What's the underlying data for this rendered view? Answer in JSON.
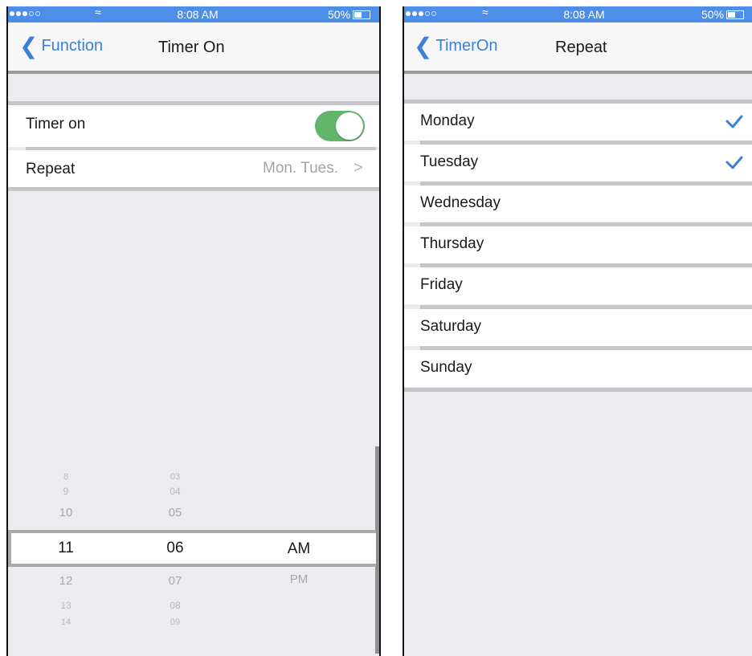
{
  "left_screen": {
    "status": {
      "time": "8:08 AM",
      "battery": "50%"
    },
    "nav": {
      "back_label": "Function",
      "title": "Timer On"
    },
    "rows": {
      "timer_on_label": "Timer on",
      "timer_on_state": true,
      "repeat_label": "Repeat",
      "repeat_value": "Mon. Tues."
    },
    "picker": {
      "hours": {
        "above": [
          "8",
          "9",
          "10"
        ],
        "selected": "11",
        "below": [
          "12",
          "13",
          "14"
        ]
      },
      "minutes": {
        "above": [
          "03",
          "04",
          "05"
        ],
        "selected": "06",
        "below": [
          "07",
          "08",
          "09"
        ]
      },
      "period": {
        "selected": "AM",
        "below": [
          "PM"
        ]
      }
    }
  },
  "right_screen": {
    "status": {
      "time": "8:08 AM",
      "battery": "50%"
    },
    "nav": {
      "back_label": "TimerOn",
      "title": "Repeat"
    },
    "days": [
      {
        "label": "Monday",
        "checked": true
      },
      {
        "label": "Tuesday",
        "checked": true
      },
      {
        "label": "Wednesday",
        "checked": false
      },
      {
        "label": "Thursday",
        "checked": false
      },
      {
        "label": "Friday",
        "checked": false
      },
      {
        "label": "Saturday",
        "checked": false
      },
      {
        "label": "Sunday",
        "checked": false
      }
    ]
  },
  "colors": {
    "status_bar": "#4d8fe8",
    "accent_blue": "#3a7fd8",
    "toggle_on": "#62b66c",
    "background": "#ececf0"
  },
  "icons": {
    "back": "chevron-left-icon",
    "disclosure": "chevron-right-icon",
    "check": "checkmark-icon",
    "wifi": "wifi-icon",
    "battery": "battery-icon",
    "signal": "signal-dots-icon"
  }
}
